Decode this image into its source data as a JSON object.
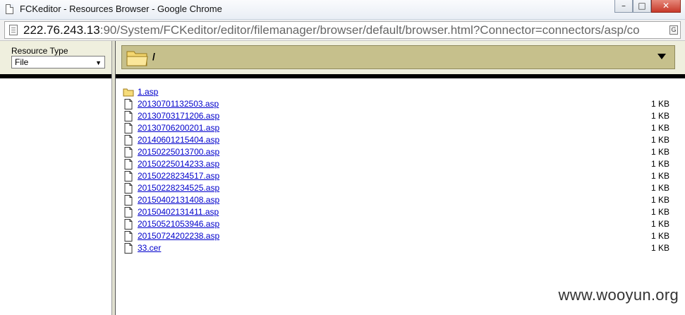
{
  "window": {
    "title": "FCKeditor - Resources Browser - Google Chrome",
    "minimize_glyph": "–",
    "maximize_glyph": "□",
    "close_glyph": "✕"
  },
  "address": {
    "host": "222.76.243.13",
    "rest": ":90/System/FCKeditor/editor/filemanager/browser/default/browser.html?Connector=connectors/asp/co",
    "translate_glyph": "G"
  },
  "left_panel": {
    "resource_type_label": "Resource Type",
    "resource_type_value": "File"
  },
  "folder_bar": {
    "current_path": "/"
  },
  "files": [
    {
      "name": "1.asp",
      "type": "folder",
      "size": ""
    },
    {
      "name": "20130701132503.asp",
      "type": "file",
      "size": "1 KB"
    },
    {
      "name": "20130703171206.asp",
      "type": "file",
      "size": "1 KB"
    },
    {
      "name": "20130706200201.asp",
      "type": "file",
      "size": "1 KB"
    },
    {
      "name": "20140601215404.asp",
      "type": "file",
      "size": "1 KB"
    },
    {
      "name": "20150225013700.asp",
      "type": "file",
      "size": "1 KB"
    },
    {
      "name": "20150225014233.asp",
      "type": "file",
      "size": "1 KB"
    },
    {
      "name": "20150228234517.asp",
      "type": "file",
      "size": "1 KB"
    },
    {
      "name": "20150228234525.asp",
      "type": "file",
      "size": "1 KB"
    },
    {
      "name": "20150402131408.asp",
      "type": "file",
      "size": "1 KB"
    },
    {
      "name": "20150402131411.asp",
      "type": "file",
      "size": "1 KB"
    },
    {
      "name": "20150521053946.asp",
      "type": "file",
      "size": "1 KB"
    },
    {
      "name": "20150724202238.asp",
      "type": "file",
      "size": "1 KB"
    },
    {
      "name": "33.cer",
      "type": "file",
      "size": "1 KB"
    }
  ],
  "watermark": "www.wooyun.org",
  "colors": {
    "folder_bar": "#c6c08c",
    "panel_bg": "#efefde",
    "link": "#0000cc"
  }
}
